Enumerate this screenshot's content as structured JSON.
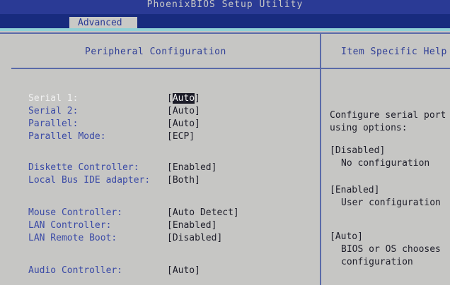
{
  "window": {
    "title": "PhoenixBIOS Setup Utility"
  },
  "menu": {
    "active_tab": "Advanced"
  },
  "panel": {
    "title": "Peripheral Configuration"
  },
  "help": {
    "title": "Item Specific Help",
    "lines": [
      "Configure serial port",
      "using options:",
      "[Disabled]",
      "No configuration",
      "[Enabled]",
      "User configuration",
      "[Auto]",
      "BIOS or OS chooses",
      "configuration"
    ]
  },
  "settings": [
    {
      "label": "Serial 1:",
      "value": "Auto"
    },
    {
      "label": "Serial 2:",
      "value": "[Auto]"
    },
    {
      "label": "Parallel:",
      "value": "[Auto]"
    },
    {
      "label": "Parallel Mode:",
      "value": "[ECP]"
    },
    {
      "label": "Diskette Controller:",
      "value": "[Enabled]"
    },
    {
      "label": "Local Bus IDE adapter:",
      "value": "[Both]"
    },
    {
      "label": "Mouse Controller:",
      "value": "[Auto Detect]"
    },
    {
      "label": "LAN Controller:",
      "value": "[Enabled]"
    },
    {
      "label": "LAN Remote Boot:",
      "value": "[Disabled]"
    },
    {
      "label": "Audio Controller:",
      "value": "[Auto]"
    }
  ],
  "colors": {
    "blue": "#2a3a95",
    "cyan": "#8fd0d6",
    "gray": "#c6c6c4"
  }
}
